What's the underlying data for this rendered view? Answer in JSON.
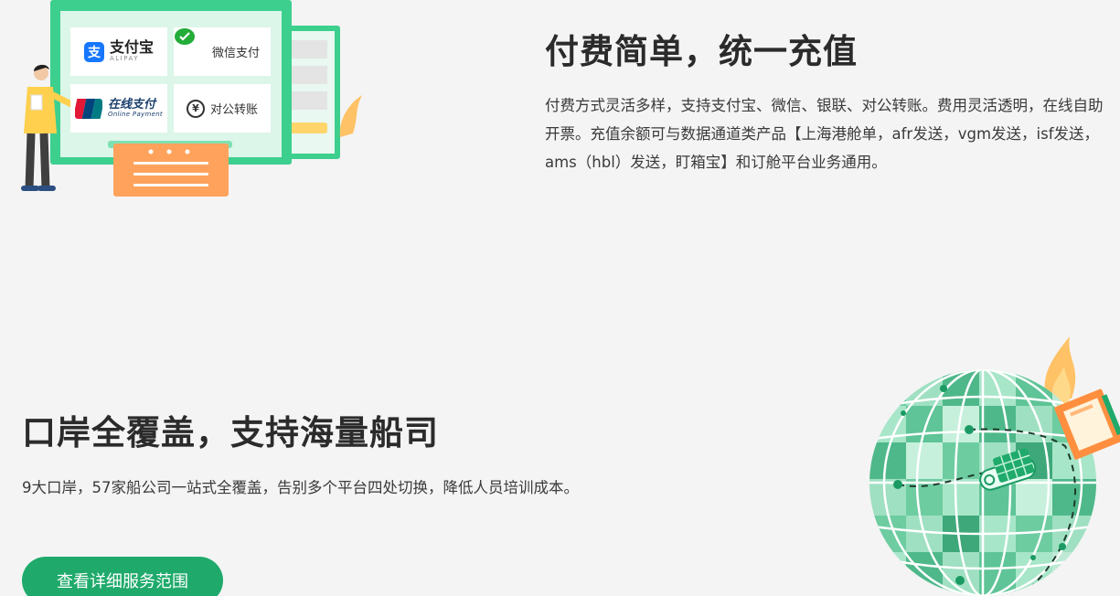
{
  "payment": {
    "title": "付费简单，统一充值",
    "description": "付费方式灵活多样，支持支付宝、微信、银联、对公转账。费用灵活透明，在线自助开票。充值余额可与数据通道类产品【上海港舱单，afr发送，vgm发送，isf发送，ams（hbl）发送，盯箱宝】和订舱平台业务通用。",
    "methods": {
      "alipay": {
        "name": "支付宝",
        "sub": "ALIPAY",
        "icon": "alipay-icon",
        "color": "#1677ff"
      },
      "wechat": {
        "name": "微信支付",
        "icon": "wechat-pay-icon",
        "color": "#22ac38"
      },
      "unionpay": {
        "name": "在线支付",
        "sub": "Online Payment",
        "icon": "unionpay-icon"
      },
      "corporate": {
        "name": "对公转账",
        "icon": "yen-coin-icon"
      }
    }
  },
  "ports": {
    "title": "口岸全覆盖，支持海量船司",
    "description": "9大口岸，57家船公司一站式全覆盖，告别多个平台四处切换，降低人员培训成本。",
    "button_label": "查看详细服务范围"
  },
  "theme": {
    "accent": "#1faa6b",
    "panel_green": "#3ccf8e",
    "orange": "#ffa35c",
    "background": "#f4f4f4"
  }
}
